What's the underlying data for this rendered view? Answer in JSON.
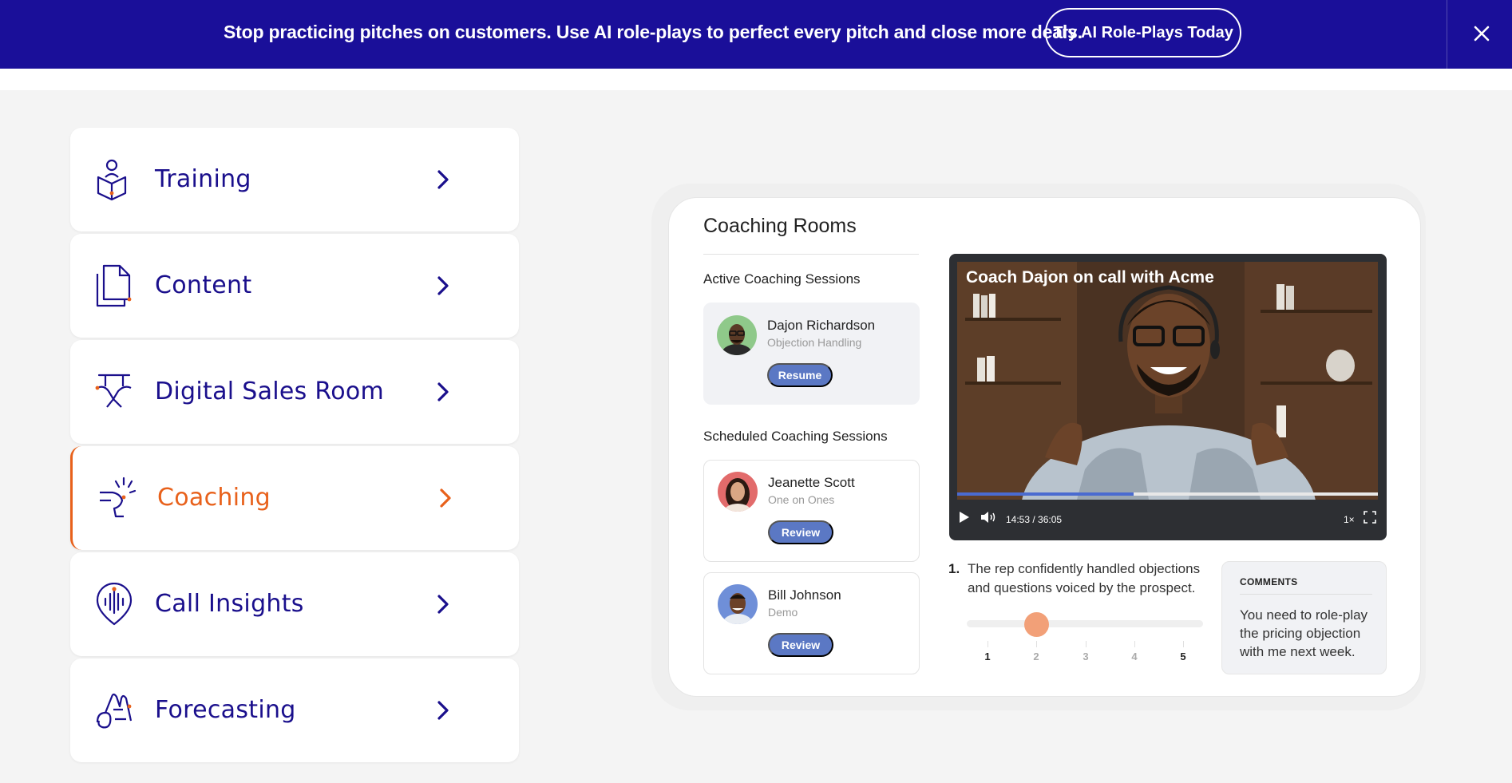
{
  "banner": {
    "message": "Stop practicing pitches on customers. Use AI role-plays to perfect every pitch and close more deals.",
    "cta_label": "Try AI Role-Plays Today",
    "close_icon": "close-icon",
    "background": "#1a0f99"
  },
  "nav": {
    "items": [
      {
        "label": "Training",
        "icon": "training-icon"
      },
      {
        "label": "Content",
        "icon": "content-icon"
      },
      {
        "label": "Digital Sales Room",
        "icon": "digital-sales-room-icon"
      },
      {
        "label": "Coaching",
        "icon": "coaching-icon",
        "active": true
      },
      {
        "label": "Call Insights",
        "icon": "call-insights-icon"
      },
      {
        "label": "Forecasting",
        "icon": "forecasting-icon"
      }
    ],
    "text_color": "#1a0f8c",
    "active_color": "#e8611b"
  },
  "coaching": {
    "title": "Coaching Rooms",
    "active_section_label": "Active Coaching Sessions",
    "scheduled_section_label": "Scheduled Coaching Sessions",
    "active_sessions": [
      {
        "name": "Dajon Richardson",
        "type": "Objection Handling",
        "action": "Resume"
      }
    ],
    "scheduled_sessions": [
      {
        "name": "Jeanette Scott",
        "type": "One on Ones",
        "action": "Review"
      },
      {
        "name": "Bill Johnson",
        "type": "Demo",
        "action": "Review"
      }
    ],
    "video": {
      "title": "Coach Dajon on call with Acme",
      "time": "14:53 / 36:05",
      "progress_fraction": 0.42,
      "speed": "1×"
    },
    "rating": {
      "number": "1.",
      "question": "The rep confidently handled objections and questions voiced by the prospect.",
      "value": 2,
      "scale": [
        "1",
        "2",
        "3",
        "4",
        "5"
      ]
    },
    "comments": {
      "heading": "COMMENTS",
      "text": "You need to role-play the pricing objection with me next week."
    },
    "button_color": "#5b78c4"
  }
}
